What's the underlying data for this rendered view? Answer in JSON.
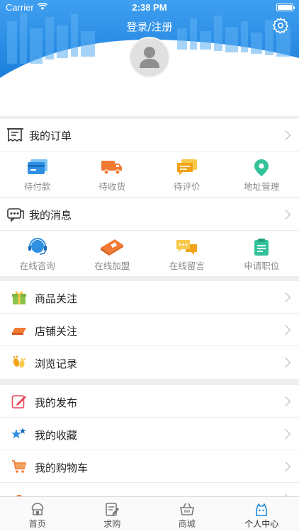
{
  "status_bar": {
    "carrier": "Carrier",
    "time": "2:38 PM"
  },
  "header": {
    "login_label": "登录/注册"
  },
  "orders": {
    "title": "我的订单",
    "items": [
      {
        "label": "待付款",
        "icon": "card-icon"
      },
      {
        "label": "待收货",
        "icon": "truck-icon"
      },
      {
        "label": "待评价",
        "icon": "comment-icon"
      },
      {
        "label": "地址管理",
        "icon": "location-pin-icon"
      }
    ]
  },
  "messages": {
    "title": "我的消息",
    "items": [
      {
        "label": "在线咨询",
        "icon": "headset-icon"
      },
      {
        "label": "在线加盟",
        "icon": "join-icon"
      },
      {
        "label": "在线留言",
        "icon": "chat-bubbles-icon"
      },
      {
        "label": "申请职位",
        "icon": "clipboard-icon"
      }
    ]
  },
  "follow_rows": [
    {
      "label": "商品关注",
      "icon": "gift-icon"
    },
    {
      "label": "店铺关注",
      "icon": "shop-icon"
    },
    {
      "label": "浏览记录",
      "icon": "footprint-icon"
    }
  ],
  "mine_rows": [
    {
      "label": "我的发布",
      "icon": "edit-icon"
    },
    {
      "label": "我的收藏",
      "icon": "stars-icon"
    },
    {
      "label": "我的购物车",
      "icon": "cart-icon"
    }
  ],
  "tabbar": [
    {
      "label": "首页",
      "icon": "home-icon"
    },
    {
      "label": "求购",
      "icon": "purchase-icon"
    },
    {
      "label": "商城",
      "icon": "basket-icon"
    },
    {
      "label": "个人中心",
      "icon": "profile-icon",
      "active": true
    }
  ],
  "colors": {
    "accent_blue": "#1e8be0",
    "chevron": "#b5b5b5",
    "label_gray": "#8a8a8a"
  }
}
